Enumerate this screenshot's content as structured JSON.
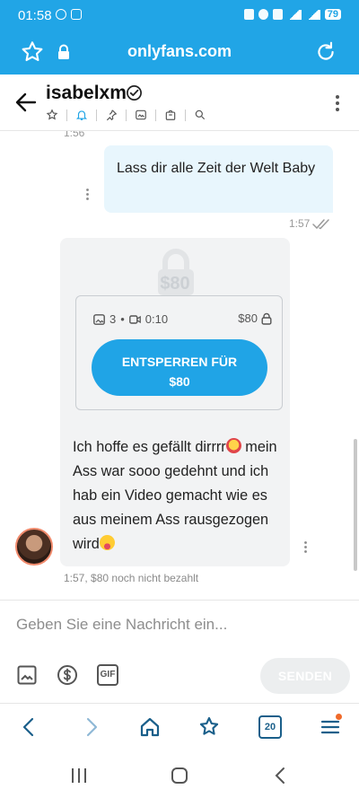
{
  "status": {
    "time": "01:58",
    "battery": "79"
  },
  "browser": {
    "url": "onlyfans.com"
  },
  "chat_header": {
    "username": "isabelxm"
  },
  "messages": {
    "prev_timestamp": "1:56",
    "outgoing": {
      "text": "Lass dir alle Zeit der Welt Baby",
      "time": "1:57"
    },
    "ppv": {
      "background_price": "$80",
      "image_count": "3",
      "separator": "•",
      "video_duration": "0:10",
      "price": "$80",
      "unlock_line1": "ENTSPERREN FÜR",
      "unlock_line2": "$80",
      "text_part1": "Ich hoffe es gefällt dirrrr",
      "text_part2": " mein Ass war sooo gedehnt und ich hab ein Video gemacht wie es aus meinem Ass rausgezogen wird",
      "time": "1:57,",
      "status": "$80 noch nicht bezahlt"
    }
  },
  "composer": {
    "placeholder": "Geben Sie eine Nachricht ein...",
    "send_label": "SENDEN",
    "gif_label": "GIF"
  },
  "toolbar": {
    "tabs_count": "20"
  },
  "colors": {
    "brand": "#21a5e6",
    "button": "#20a4e6",
    "outgoing_bubble": "#e8f6fd"
  }
}
